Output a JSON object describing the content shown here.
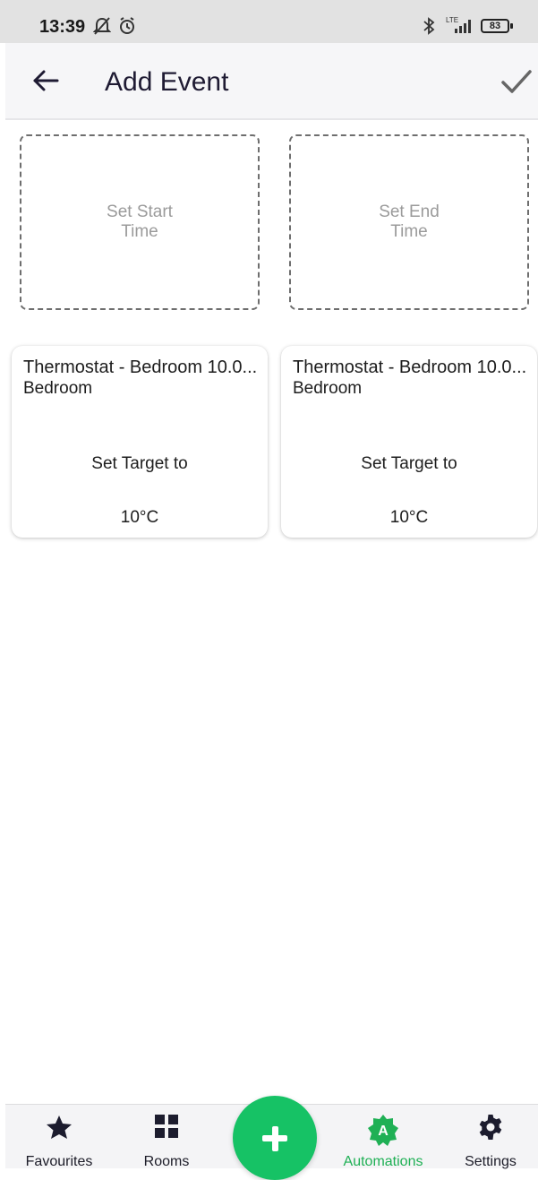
{
  "status_bar": {
    "time": "13:39",
    "battery": "83",
    "network": "LTE"
  },
  "app_bar": {
    "title": "Add Event"
  },
  "time_slots": {
    "start_line1": "Set Start",
    "start_line2": "Time",
    "end_line1": "Set End",
    "end_line2": "Time"
  },
  "cards": [
    {
      "title": "Thermostat - Bedroom 10.0...",
      "room": "Bedroom",
      "action": "Set Target to",
      "value": "10°C"
    },
    {
      "title": "Thermostat - Bedroom 10.0...",
      "room": "Bedroom",
      "action": "Set Target to",
      "value": "10°C"
    }
  ],
  "bottom_nav": {
    "items": [
      {
        "label": "Favourites",
        "icon": "star-icon"
      },
      {
        "label": "Rooms",
        "icon": "grid-icon"
      },
      {
        "label": "Automations",
        "icon": "automations-icon",
        "active": true
      },
      {
        "label": "Settings",
        "icon": "gear-icon"
      }
    ],
    "fab_icon": "plus-icon"
  },
  "colors": {
    "accent_green": "#16c265",
    "active_label": "#1fb055",
    "title_text": "#1f1b33",
    "placeholder_text": "#9b9b9b"
  }
}
